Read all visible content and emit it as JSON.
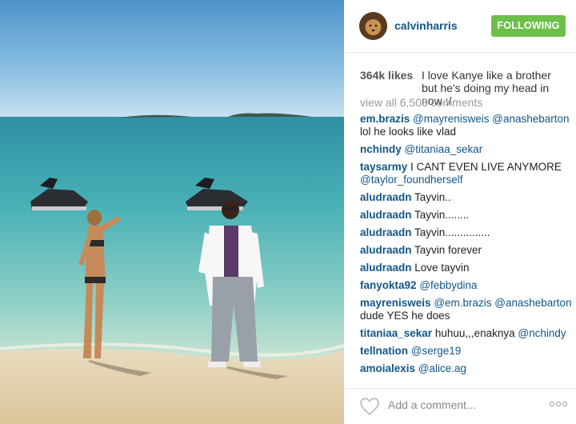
{
  "post": {
    "username": "calvinharris",
    "follow_label": "FOLLOWING",
    "likes": "364k likes",
    "caption": "I love Kanye like a brother but he's doing my head in now :/",
    "view_all": "view all 6,508 comments",
    "add_comment_placeholder": "Add a comment...",
    "accent_color": "#125688",
    "follow_color": "#6cc04a"
  },
  "comments": [
    {
      "author": "em.brazis",
      "text": "",
      "mention": "@mayrenisweis @anashebarton",
      "after": " lol he looks like vlad"
    },
    {
      "author": "nchindy",
      "text": "",
      "mention": "@titaniaa_sekar",
      "after": ""
    },
    {
      "author": "taysarmy",
      "text": " I CANT EVEN LIVE ANYMORE",
      "mention": "@taylor_foundherself",
      "after": ""
    },
    {
      "author": "aludraadn",
      "text": " Tayvin..",
      "mention": "",
      "after": ""
    },
    {
      "author": "aludraadn",
      "text": " Tayvin........",
      "mention": "",
      "after": ""
    },
    {
      "author": "aludraadn",
      "text": " Tayvin...............",
      "mention": "",
      "after": ""
    },
    {
      "author": "aludraadn",
      "text": " Tayvin forever",
      "mention": "",
      "after": ""
    },
    {
      "author": "aludraadn",
      "text": " Love tayvin",
      "mention": "",
      "after": ""
    },
    {
      "author": "fanyokta92",
      "text": "",
      "mention": "@febbydina",
      "after": ""
    },
    {
      "author": "mayrenisweis",
      "text": "",
      "mention": "@em.brazis @anashebarton",
      "after": " dude YES he does"
    },
    {
      "author": "titaniaa_sekar",
      "text": " huhuu,,,enaknya ",
      "mention": "@nchindy",
      "after": ""
    },
    {
      "author": "tellnation",
      "text": "",
      "mention": "@serge19",
      "after": ""
    },
    {
      "author": "amoialexis",
      "text": "",
      "mention": "@alice.ag",
      "after": ""
    }
  ],
  "icons": {
    "avatar": "lion-avatar",
    "like": "heart-icon",
    "options": "more-options-icon"
  }
}
